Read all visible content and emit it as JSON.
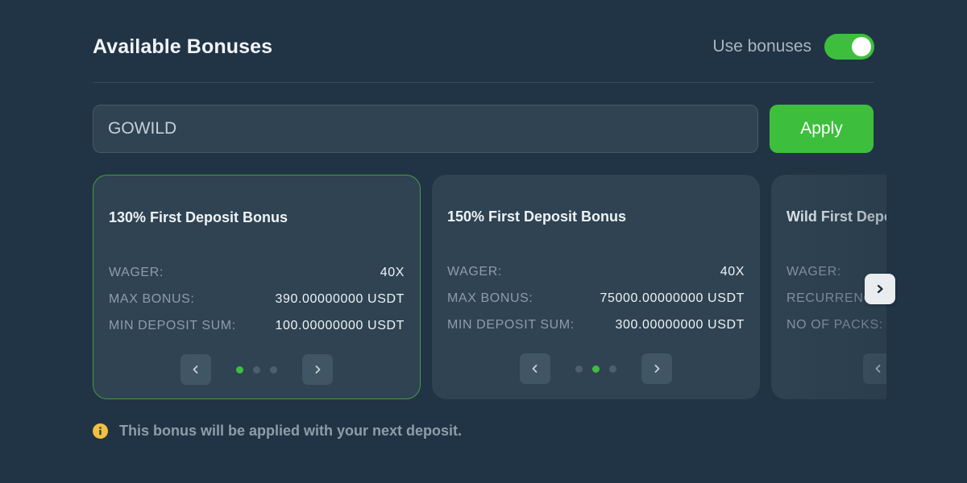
{
  "header": {
    "title": "Available Bonuses",
    "toggle_label": "Use bonuses",
    "toggle_on": true
  },
  "promo": {
    "value": "GOWILD",
    "apply_label": "Apply"
  },
  "cards": [
    {
      "title": "130% First Deposit Bonus",
      "selected": true,
      "rows": [
        {
          "label": "WAGER:",
          "value": "40X"
        },
        {
          "label": "MAX BONUS:",
          "value": "390.00000000 USDT"
        },
        {
          "label": "MIN DEPOSIT SUM:",
          "value": "100.00000000 USDT"
        }
      ],
      "active_dot": 0
    },
    {
      "title": "150% First Deposit Bonus",
      "selected": false,
      "rows": [
        {
          "label": "WAGER:",
          "value": "40X"
        },
        {
          "label": "MAX BONUS:",
          "value": "75000.00000000 USDT"
        },
        {
          "label": "MIN DEPOSIT SUM:",
          "value": "300.00000000 USDT"
        }
      ],
      "active_dot": 1
    },
    {
      "title": "Wild First Depo",
      "selected": false,
      "rows": [
        {
          "label": "WAGER:",
          "value": ""
        },
        {
          "label": "RECURRENCE",
          "value": ""
        },
        {
          "label": "NO OF PACKS:",
          "value": ""
        }
      ],
      "active_dot": 0
    }
  ],
  "footer": {
    "note": "This bonus will be applied with your next deposit."
  },
  "colors": {
    "background": "#213445",
    "card": "#2f4352",
    "accent": "#3dbf3d",
    "info": "#f0c040"
  },
  "icons": [
    "chevron-left-icon",
    "chevron-right-icon",
    "info-icon"
  ]
}
